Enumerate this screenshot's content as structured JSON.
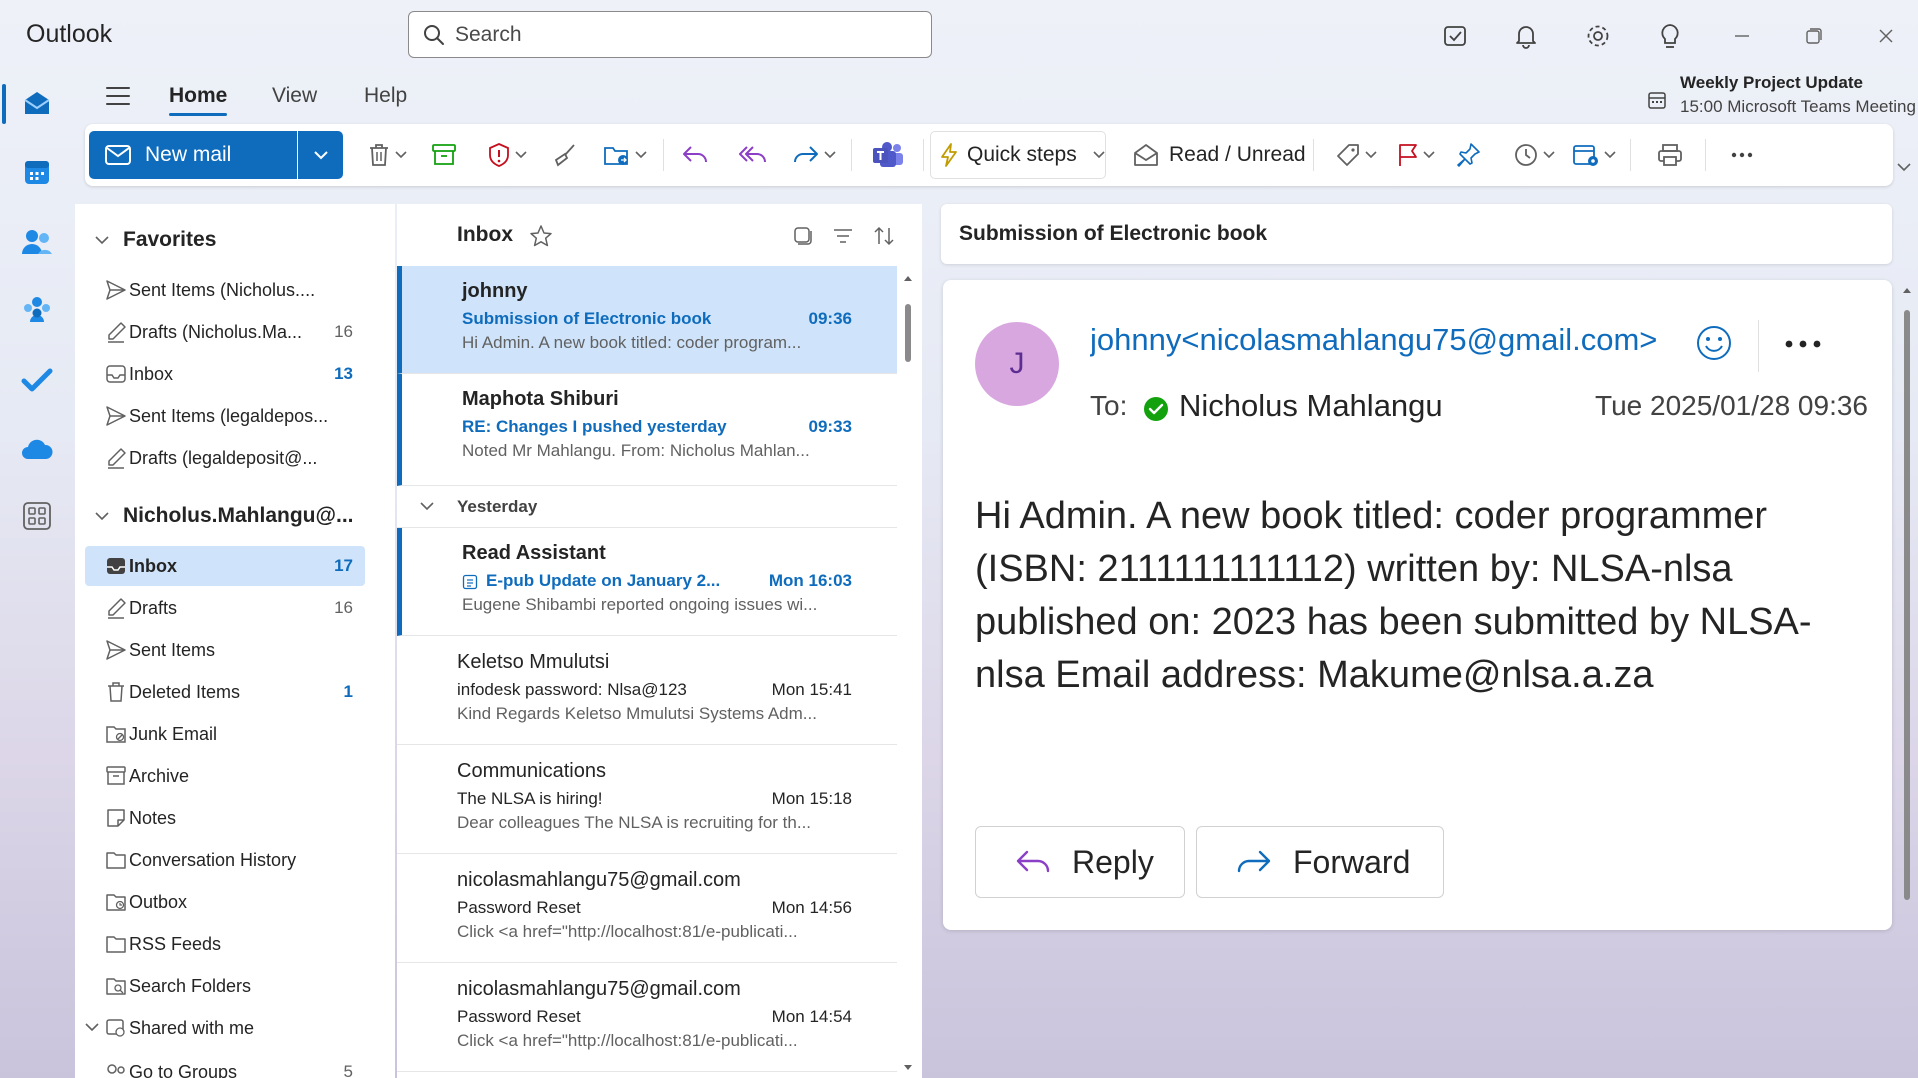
{
  "app": {
    "title": "Outlook"
  },
  "search": {
    "placeholder": "Search"
  },
  "ribbon": {
    "tabs": [
      "Home",
      "View",
      "Help"
    ],
    "new_mail": "New mail",
    "quick_steps": "Quick steps",
    "read_unread": "Read / Unread"
  },
  "meeting": {
    "title": "Weekly Project Update",
    "subtitle": "15:00 Microsoft Teams Meeting"
  },
  "folders": {
    "favorites_label": "Favorites",
    "favorites": [
      {
        "label": "Sent Items (Nicholus....",
        "count": "",
        "icon": "send-icon"
      },
      {
        "label": "Drafts (Nicholus.Ma...",
        "count": "16",
        "icon": "drafts-icon"
      },
      {
        "label": "Inbox",
        "count": "13",
        "icon": "inbox-icon"
      },
      {
        "label": "Sent Items (legaldepos...",
        "count": "",
        "icon": "send-icon"
      },
      {
        "label": "Drafts (legaldeposit@...",
        "count": "",
        "icon": "drafts-icon"
      }
    ],
    "account_label": "Nicholus.Mahlangu@...",
    "account": [
      {
        "label": "Inbox",
        "count": "17",
        "icon": "inbox-icon"
      },
      {
        "label": "Drafts",
        "count": "16",
        "icon": "drafts-icon"
      },
      {
        "label": "Sent Items",
        "count": "",
        "icon": "send-icon"
      },
      {
        "label": "Deleted Items",
        "count": "1",
        "icon": "trash-icon"
      },
      {
        "label": "Junk Email",
        "count": "",
        "icon": "junk-folder-icon"
      },
      {
        "label": "Archive",
        "count": "",
        "icon": "archive-icon"
      },
      {
        "label": "Notes",
        "count": "",
        "icon": "notes-icon"
      },
      {
        "label": "Conversation History",
        "count": "",
        "icon": "folder-icon"
      },
      {
        "label": "Outbox",
        "count": "",
        "icon": "outbox-icon"
      },
      {
        "label": "RSS Feeds",
        "count": "",
        "icon": "folder-icon"
      },
      {
        "label": "Search Folders",
        "count": "",
        "icon": "search-folder-icon"
      }
    ],
    "shared_label": "Shared with me",
    "partial_label": "Go to Groups",
    "partial_count": "5"
  },
  "message_list": {
    "title": "Inbox",
    "group_yesterday": "Yesterday",
    "messages": [
      {
        "sender": "johnny",
        "subject": "Submission of Electronic book",
        "time": "09:36",
        "preview": "Hi Admin. A new book titled: coder program..."
      },
      {
        "sender": "Maphota Shiburi",
        "subject": "RE: Changes I pushed yesterday",
        "time": "09:33",
        "preview": "Noted Mr Mahlangu. From: Nicholus Mahlan..."
      },
      {
        "sender": "Read Assistant",
        "subject": "E-pub Update on January 2...",
        "time": "Mon 16:03",
        "preview": "Eugene Shibambi reported ongoing issues wi..."
      },
      {
        "sender": "Keletso Mmulutsi",
        "subject": "infodesk password: Nlsa@123",
        "time": "Mon 15:41",
        "preview": "Kind Regards Keletso Mmulutsi Systems Adm..."
      },
      {
        "sender": "Communications",
        "subject": "The NLSA is hiring!",
        "time": "Mon 15:18",
        "preview": "Dear colleagues The NLSA is recruiting for th..."
      },
      {
        "sender": "nicolasmahlangu75@gmail.com",
        "subject": "Password Reset",
        "time": "Mon 14:56",
        "preview": "Click <a href=\"http://localhost:81/e-publicati..."
      },
      {
        "sender": "nicolasmahlangu75@gmail.com",
        "subject": "Password Reset",
        "time": "Mon 14:54",
        "preview": "Click <a href=\"http://localhost:81/e-publicati..."
      }
    ]
  },
  "reading": {
    "subject": "Submission of Electronic book",
    "avatar_initial": "J",
    "from": "johnny<nicolasmahlangu75@gmail.com>",
    "to_label": "To:",
    "to_name": "Nicholus Mahlangu",
    "date": "Tue 2025/01/28 09:36",
    "body": "Hi Admin. A new book titled: coder programmer (ISBN: 2111111111112) written by: NLSA-nlsa published on: 2023 has been submitted by NLSA-nlsa Email address: Makume@nlsa.a.za",
    "reply": "Reply",
    "forward": "Forward"
  },
  "colors": {
    "accent": "#0f6cbd",
    "selected": "#cfe4fa",
    "avatar": "#d9a7e0",
    "presence": "#13a10e"
  }
}
